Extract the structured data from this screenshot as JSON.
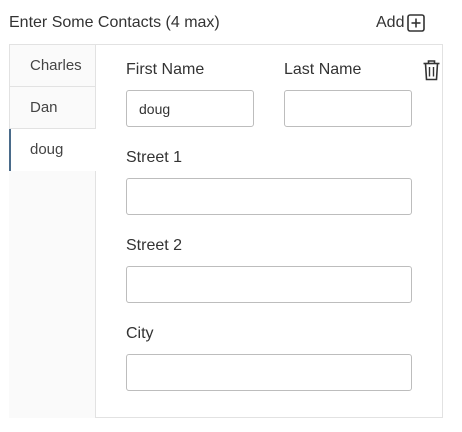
{
  "header": {
    "title": "Enter Some Contacts (4 max)",
    "add_label": "Add"
  },
  "tabs": [
    {
      "label": "Charles",
      "active": false
    },
    {
      "label": "Dan",
      "active": false
    },
    {
      "label": "doug",
      "active": true
    }
  ],
  "form": {
    "first_name": {
      "label": "First Name",
      "value": "doug"
    },
    "last_name": {
      "label": "Last Name",
      "value": ""
    },
    "street1": {
      "label": "Street 1",
      "value": ""
    },
    "street2": {
      "label": "Street 2",
      "value": ""
    },
    "city": {
      "label": "City",
      "value": ""
    }
  },
  "icons": {
    "add": "plus-square-icon",
    "delete": "trash-icon"
  },
  "colors": {
    "active_tab_accent": "#4a6b8a",
    "border": "#e2e2e2",
    "input_border": "#bdbdbd",
    "tab_background": "#fafafa"
  }
}
